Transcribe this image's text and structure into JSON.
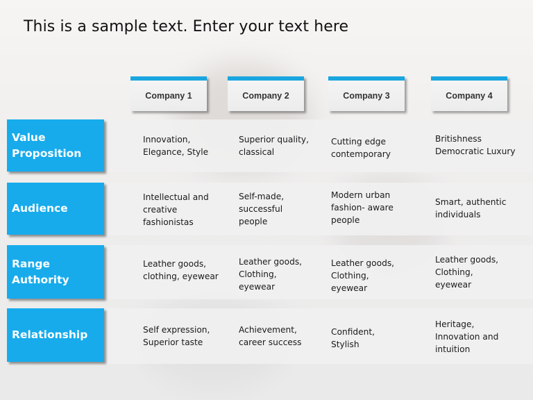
{
  "title": "This is a sample text. Enter your text here",
  "colors": {
    "accent": "#17abec",
    "header_top": "#1aa6e0",
    "text": "#1a1a1a"
  },
  "columns": [
    "Company 1",
    "Company 2",
    "Company 3",
    "Company 4"
  ],
  "rows": [
    {
      "label": "Value Proposition",
      "cells": [
        "Innovation, Elegance, Style",
        "Superior quality, classical",
        "Cutting edge contemporary",
        "Britishness Democratic Luxury"
      ]
    },
    {
      "label": "Audience",
      "cells": [
        "Intellectual and creative fashionistas",
        "Self-made, successful people",
        "Modern urban fashion- aware people",
        "Smart, authentic individuals"
      ]
    },
    {
      "label": "Range Authority",
      "cells": [
        "Leather goods, clothing, eyewear",
        "Leather goods, Clothing, eyewear",
        "Leather goods, Clothing, eyewear",
        "Leather goods, Clothing, eyewear"
      ]
    },
    {
      "label": "Relationship",
      "cells": [
        "Self expression, Superior taste",
        "Achievement, career success",
        "Confident, Stylish",
        "Heritage, Innovation and intuition"
      ]
    }
  ]
}
